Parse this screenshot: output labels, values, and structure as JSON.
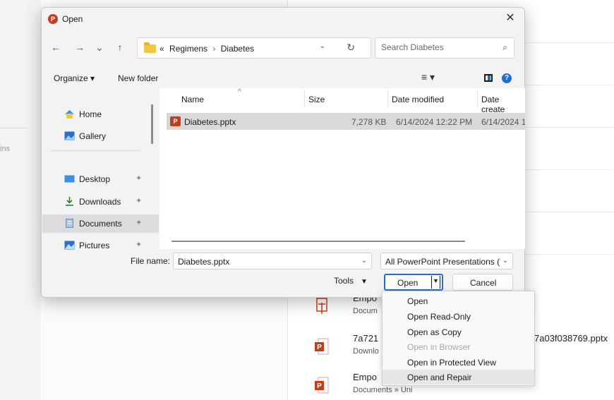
{
  "background": {
    "side_text": "ins",
    "recent": [
      {
        "name": "Empo",
        "location": "Docum",
        "icon": "ppt-icon"
      },
      {
        "name": "7a721",
        "location": "Downlo",
        "icon": "ppt-icon"
      },
      {
        "name": "Empo",
        "location": "Documents » Uni",
        "icon": "ppt-icon"
      }
    ],
    "truncated_filename": "7a03f038769.pptx"
  },
  "dialog": {
    "title": "Open",
    "app_icon_letter": "P",
    "close_glyph": "✕",
    "nav": {
      "back": "←",
      "forward": "→",
      "recent": "⌄",
      "up": "↑"
    },
    "address": {
      "prefix": "«",
      "crumbs": [
        "Regimens",
        "Diabetes"
      ],
      "separator": "›",
      "dropdown": "⌄",
      "refresh": "↻"
    },
    "search": {
      "placeholder": "Search Diabetes",
      "icon": "⌕"
    },
    "toolbar": {
      "organize": "Organize ▾",
      "new_folder": "New folder",
      "view_glyph": "≡ ▾",
      "help": "?"
    },
    "sidebar": {
      "items": [
        {
          "label": "Home",
          "icon": "home-icon",
          "pinned": false,
          "selected": false
        },
        {
          "label": "Gallery",
          "icon": "gallery-icon",
          "pinned": false,
          "selected": false
        },
        {
          "label": "Desktop",
          "icon": "desktop-icon",
          "pinned": true,
          "selected": false
        },
        {
          "label": "Downloads",
          "icon": "download-icon",
          "pinned": true,
          "selected": false
        },
        {
          "label": "Documents",
          "icon": "documents-icon",
          "pinned": true,
          "selected": true
        },
        {
          "label": "Pictures",
          "icon": "pictures-icon",
          "pinned": true,
          "selected": false
        }
      ],
      "pin_glyph": "📌"
    },
    "columns": [
      "Name",
      "Size",
      "Date modified",
      "Date create"
    ],
    "sort_glyph": "^",
    "files": [
      {
        "name": "Diabetes.pptx",
        "size": "7,278 KB",
        "modified": "6/14/2024 12:22 PM",
        "created": "6/14/2024 1"
      }
    ],
    "file_name_label": "File name:",
    "file_name_value": "Diabetes.pptx",
    "file_type": "All PowerPoint Presentations (*",
    "tools_label": "Tools",
    "open_label": "Open",
    "cancel_label": "Cancel"
  },
  "open_menu": {
    "items": [
      {
        "label": "Open",
        "disabled": false
      },
      {
        "label": "Open Read-Only",
        "disabled": false
      },
      {
        "label": "Open as Copy",
        "disabled": false
      },
      {
        "label": "Open in Browser",
        "disabled": true
      },
      {
        "label": "Open in Protected View",
        "disabled": false
      },
      {
        "label": "Open and Repair",
        "disabled": false,
        "highlighted": true
      }
    ]
  },
  "colors": {
    "accent": "#1f6fd1",
    "powerpoint": "#c43e1c",
    "folder": "#f2c744"
  }
}
